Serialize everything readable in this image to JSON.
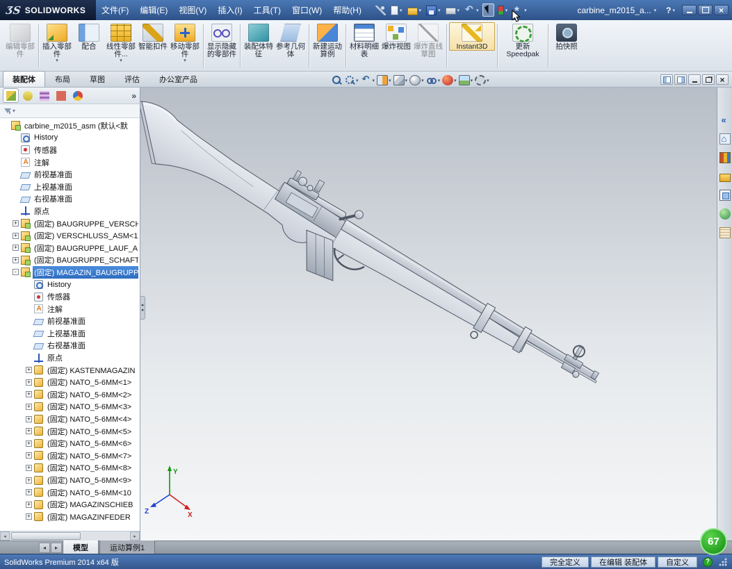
{
  "window": {
    "brand_prefix": "ƷS",
    "brand": "SOLIDWORKS",
    "doc_title": "carbine_m2015_a...",
    "help_label": "?"
  },
  "colors": {
    "titlebar_blue": "#3f6cab",
    "logo_navy": "#13203c",
    "selection_blue": "#2f6cc0",
    "ribbon_bg": "#e6ebf1",
    "viewport_top": "#b7bec7",
    "viewport_bottom": "#f5f6f7",
    "instant3d_active_bg": "#f4dfa6",
    "status_help_green": "#28a428",
    "badge_green": "#128c12",
    "component_yellow": "#f0b025"
  },
  "menu": {
    "items": [
      "文件(F)",
      "编辑(E)",
      "视图(V)",
      "插入(I)",
      "工具(T)",
      "窗口(W)",
      "帮助(H)"
    ]
  },
  "qat": {
    "items": [
      {
        "icon": "pin-icon"
      },
      {
        "icon": "new-file-icon",
        "dd": "true"
      },
      {
        "icon": "open-file-icon",
        "dd": "true"
      },
      {
        "icon": "save-icon",
        "dd": "true"
      },
      {
        "icon": "print-icon",
        "dd": "true"
      },
      {
        "icon": "undo-icon",
        "dd": "true"
      },
      {
        "icon": "select-arrow-icon",
        "pressed": "true"
      },
      {
        "icon": "rebuild-icon",
        "dd": "true"
      },
      {
        "icon": "options-icon",
        "dd": "true"
      }
    ]
  },
  "titlebar_buttons": [
    {
      "icon": "minimize-icon"
    },
    {
      "icon": "maximize-icon"
    },
    {
      "icon": "close-icon"
    }
  ],
  "ribbon": {
    "buttons": [
      {
        "label": "编辑零部件",
        "icon": "edit-component-icon",
        "disabled": "true"
      },
      {
        "type": "sep"
      },
      {
        "label": "插入零部件",
        "icon": "insert-component-icon",
        "dd": "true"
      },
      {
        "label": "配合",
        "icon": "mate-icon"
      },
      {
        "label": "线性零部件...",
        "icon": "linear-pattern-icon",
        "dd": "true"
      },
      {
        "label": "智能扣件",
        "icon": "smart-fasteners-icon"
      },
      {
        "label": "移动零部件",
        "icon": "move-component-icon",
        "dd": "true"
      },
      {
        "type": "sep"
      },
      {
        "label": "显示隐藏的零部件",
        "icon": "show-hidden-components-icon"
      },
      {
        "type": "sep"
      },
      {
        "label": "装配体特征",
        "icon": "assembly-features-icon"
      },
      {
        "label": "参考几何体",
        "icon": "reference-geometry-icon"
      },
      {
        "type": "sep"
      },
      {
        "label": "新建运动算例",
        "icon": "new-motion-study-icon"
      },
      {
        "type": "sep"
      },
      {
        "label": "材料明细表",
        "icon": "bill-of-materials-icon"
      },
      {
        "label": "爆炸视图",
        "icon": "exploded-view-icon"
      },
      {
        "label": "爆炸直线草图",
        "icon": "explode-line-sketch-icon",
        "disabled": "true"
      },
      {
        "type": "sep"
      },
      {
        "label": "Instant3D",
        "icon": "instant3d-icon",
        "active": "true",
        "cls": "wide"
      },
      {
        "type": "sep"
      },
      {
        "label": "更新Speedpak",
        "icon": "update-speedpak-icon",
        "cls": "wide"
      },
      {
        "type": "sep"
      },
      {
        "label": "拍快照",
        "icon": "take-snapshot-icon"
      }
    ]
  },
  "cm_tabs": {
    "items": [
      {
        "label": "装配体",
        "active": "true"
      },
      {
        "label": "布局"
      },
      {
        "label": "草图"
      },
      {
        "label": "评估"
      },
      {
        "label": "办公室产品"
      }
    ]
  },
  "headsup": {
    "items": [
      {
        "icon": "zoom-fit-icon"
      },
      {
        "icon": "zoom-area-icon",
        "dd": "true"
      },
      {
        "icon": "previous-view-icon",
        "dd": "true"
      },
      {
        "icon": "section-view-icon",
        "dd": "true"
      },
      {
        "icon": "view-orientation-icon",
        "dd": "true"
      },
      {
        "icon": "display-style-icon",
        "dd": "true"
      },
      {
        "icon": "hide-show-items-icon",
        "dd": "true"
      },
      {
        "icon": "edit-appearance-icon",
        "dd": "true"
      },
      {
        "icon": "apply-scene-icon",
        "dd": "true"
      },
      {
        "icon": "view-settings-icon",
        "dd": "true"
      }
    ]
  },
  "child_window": {
    "buttons": [
      {
        "icon": "pane-left-icon"
      },
      {
        "icon": "pane-right-icon"
      },
      {
        "icon": "minimize-icon"
      },
      {
        "icon": "restore-icon"
      },
      {
        "icon": "close-icon"
      }
    ]
  },
  "fm": {
    "tabs": [
      {
        "icon": "feature-tree-tab-icon",
        "selected": "true"
      },
      {
        "icon": "property-manager-tab-icon"
      },
      {
        "icon": "configuration-manager-tab-icon"
      },
      {
        "icon": "dimxpert-tab-icon"
      },
      {
        "icon": "display-manager-tab-icon"
      }
    ],
    "overflow": "»",
    "filter_icon": "filter-funnel-icon",
    "filter_dd": "▾",
    "tree": {
      "items": [
        {
          "lvl": "0",
          "icon": "assembly-icon",
          "label": "carbine_m2015_asm (默认<默"
        },
        {
          "lvl": "1",
          "icon": "history-icon",
          "label": "History"
        },
        {
          "lvl": "1",
          "icon": "sensors-icon",
          "label": "传感器"
        },
        {
          "lvl": "1",
          "icon": "annotations-icon",
          "label": "注解"
        },
        {
          "lvl": "1",
          "icon": "plane-icon",
          "label": "前视基准面"
        },
        {
          "lvl": "1",
          "icon": "plane-icon",
          "label": "上视基准面"
        },
        {
          "lvl": "1",
          "icon": "plane-icon",
          "label": "右视基准面"
        },
        {
          "lvl": "1",
          "icon": "origin-icon",
          "label": "原点"
        },
        {
          "lvl": "1",
          "exp": "+",
          "icon": "assembly-icon",
          "label": "(固定) BAUGRUPPE_VERSCH"
        },
        {
          "lvl": "1",
          "exp": "+",
          "icon": "assembly-icon",
          "label": "(固定) VERSCHLUSS_ASM<1"
        },
        {
          "lvl": "1",
          "exp": "+",
          "icon": "assembly-icon",
          "label": "(固定) BAUGRUPPE_LAUF_A"
        },
        {
          "lvl": "1",
          "exp": "+",
          "icon": "assembly-icon",
          "label": "(固定) BAUGRUPPE_SCHAFT"
        },
        {
          "lvl": "1",
          "exp": "-",
          "icon": "assembly-icon",
          "label": "(固定) MAGAZIN_BAUGRUPP",
          "selected": "true"
        },
        {
          "lvl": "2",
          "icon": "history-icon",
          "label": "History"
        },
        {
          "lvl": "2",
          "icon": "sensors-icon",
          "label": "传感器"
        },
        {
          "lvl": "2",
          "icon": "annotations-icon",
          "label": "注解"
        },
        {
          "lvl": "2",
          "icon": "plane-icon",
          "label": "前视基准面"
        },
        {
          "lvl": "2",
          "icon": "plane-icon",
          "label": "上视基准面"
        },
        {
          "lvl": "2",
          "icon": "plane-icon",
          "label": "右视基准面"
        },
        {
          "lvl": "2",
          "icon": "origin-icon",
          "label": "原点"
        },
        {
          "lvl": "2",
          "exp": "+",
          "icon": "part-icon",
          "label": "(固定) KASTENMAGAZIN"
        },
        {
          "lvl": "2",
          "exp": "+",
          "icon": "part-icon",
          "label": "(固定) NATO_5-6MM<1>"
        },
        {
          "lvl": "2",
          "exp": "+",
          "icon": "part-icon",
          "label": "(固定) NATO_5-6MM<2>"
        },
        {
          "lvl": "2",
          "exp": "+",
          "icon": "part-icon",
          "label": "(固定) NATO_5-6MM<3>"
        },
        {
          "lvl": "2",
          "exp": "+",
          "icon": "part-icon",
          "label": "(固定) NATO_5-6MM<4>"
        },
        {
          "lvl": "2",
          "exp": "+",
          "icon": "part-icon",
          "label": "(固定) NATO_5-6MM<5>"
        },
        {
          "lvl": "2",
          "exp": "+",
          "icon": "part-icon",
          "label": "(固定) NATO_5-6MM<6>"
        },
        {
          "lvl": "2",
          "exp": "+",
          "icon": "part-icon",
          "label": "(固定) NATO_5-6MM<7>"
        },
        {
          "lvl": "2",
          "exp": "+",
          "icon": "part-icon",
          "label": "(固定) NATO_5-6MM<8>"
        },
        {
          "lvl": "2",
          "exp": "+",
          "icon": "part-icon",
          "label": "(固定) NATO_5-6MM<9>"
        },
        {
          "lvl": "2",
          "exp": "+",
          "icon": "part-icon",
          "label": "(固定) NATO_5-6MM<10"
        },
        {
          "lvl": "2",
          "exp": "+",
          "icon": "part-icon",
          "label": "(固定) MAGAZINSCHIEB"
        },
        {
          "lvl": "2",
          "exp": "+",
          "icon": "part-icon",
          "label": "(固定) MAGAZINFEDER"
        }
      ]
    }
  },
  "taskpane": {
    "items": [
      {
        "icon": "expand-pane-icon"
      },
      {
        "icon": "resources-home-icon"
      },
      {
        "icon": "design-library-icon"
      },
      {
        "icon": "file-explorer-icon"
      },
      {
        "icon": "view-palette-icon"
      },
      {
        "icon": "appearances-icon"
      },
      {
        "icon": "custom-properties-icon"
      }
    ]
  },
  "doc_tabs": {
    "left_arrow": "◂",
    "right_arrow": "▸",
    "items": [
      {
        "label": "模型",
        "active": "true",
        "inter": "true"
      },
      {
        "label": "运动算例1",
        "inter": "true"
      }
    ]
  },
  "statusbar": {
    "left": "SolidWorks Premium 2014 x64 版",
    "segments": [
      {
        "label": "完全定义",
        "inter": "false"
      },
      {
        "label": "在编辑 装配体",
        "inter": "false"
      },
      {
        "label": "自定义",
        "inter": "true"
      }
    ],
    "help": "?"
  },
  "overlay": {
    "badge": "67"
  },
  "viewport": {
    "model_name": "carbine_m2015_asm",
    "triad": {
      "x": "X",
      "y": "Y",
      "z": "Z"
    }
  }
}
